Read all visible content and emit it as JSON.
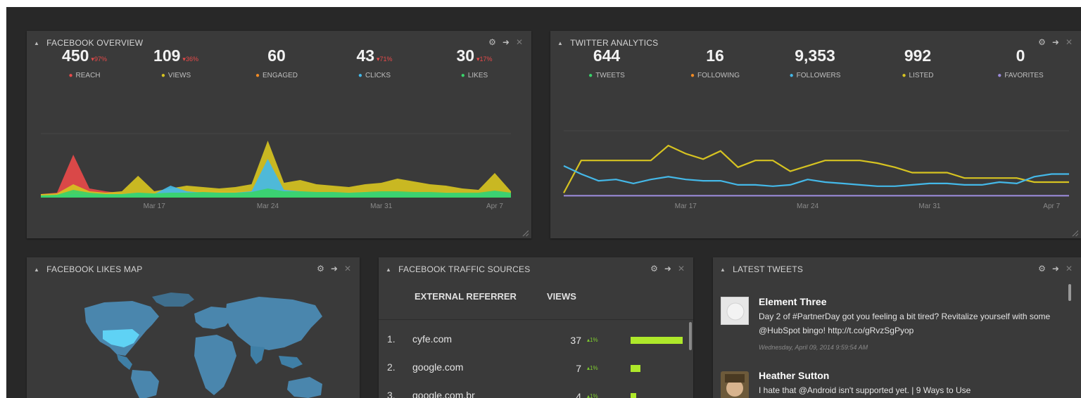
{
  "facebook_overview": {
    "title": "FACEBOOK OVERVIEW",
    "stats": [
      {
        "value": "450",
        "change": "▾97%",
        "label": "REACH",
        "color": "#e84a4a"
      },
      {
        "value": "109",
        "change": "▾36%",
        "label": "VIEWS",
        "color": "#d6c321"
      },
      {
        "value": "60",
        "change": "",
        "label": "ENGAGED",
        "color": "#f08a24"
      },
      {
        "value": "43",
        "change": "▾71%",
        "label": "CLICKS",
        "color": "#44b8e8"
      },
      {
        "value": "30",
        "change": "▾17%",
        "label": "LIKES",
        "color": "#39d36a"
      }
    ],
    "x_ticks": [
      "Mar 17",
      "Mar 24",
      "Mar 31",
      "Apr 7"
    ]
  },
  "twitter_analytics": {
    "title": "TWITTER ANALYTICS",
    "stats": [
      {
        "value": "644",
        "label": "TWEETS",
        "color": "#39d36a"
      },
      {
        "value": "16",
        "label": "FOLLOWING",
        "color": "#f08a24"
      },
      {
        "value": "9,353",
        "label": "FOLLOWERS",
        "color": "#44b8e8"
      },
      {
        "value": "992",
        "label": "LISTED",
        "color": "#d6c321"
      },
      {
        "value": "0",
        "label": "FAVORITES",
        "color": "#9a8ad8"
      }
    ],
    "x_ticks": [
      "Mar 17",
      "Mar 24",
      "Mar 31",
      "Apr 7"
    ]
  },
  "likes_map": {
    "title": "FACEBOOK LIKES MAP"
  },
  "traffic_sources": {
    "title": "FACEBOOK TRAFFIC SOURCES",
    "col_referrer": "EXTERNAL REFERRER",
    "col_views": "VIEWS",
    "rows": [
      {
        "rank": "1.",
        "name": "cyfe.com",
        "views": "37",
        "change": "▴1%",
        "share": 1.0
      },
      {
        "rank": "2.",
        "name": "google.com",
        "views": "7",
        "change": "▴1%",
        "share": 0.19
      },
      {
        "rank": "3.",
        "name": "google.com.br",
        "views": "4",
        "change": "▴1%",
        "share": 0.11
      }
    ]
  },
  "latest_tweets": {
    "title": "LATEST TWEETS",
    "tweets": [
      {
        "name": "Element Three",
        "text": "Day 2 of #PartnerDay got you feeling a bit tired? Revitalize yourself with some @HubSpot bingo! http://t.co/gRvzSgPyop",
        "time": "Wednesday, April 09, 2014 9:59:54 AM"
      },
      {
        "name": "Heather Sutton",
        "text": "I hate that @Android isn't supported yet. | 9 Ways to Use",
        "time": ""
      }
    ]
  },
  "chart_data": [
    {
      "type": "area",
      "x": [
        "Mar 10",
        "Mar 11",
        "Mar 12",
        "Mar 13",
        "Mar 14",
        "Mar 15",
        "Mar 16",
        "Mar 17",
        "Mar 18",
        "Mar 19",
        "Mar 20",
        "Mar 21",
        "Mar 22",
        "Mar 23",
        "Mar 24",
        "Mar 25",
        "Mar 26",
        "Mar 27",
        "Mar 28",
        "Mar 29",
        "Mar 30",
        "Mar 31",
        "Apr 1",
        "Apr 2",
        "Apr 3",
        "Apr 4",
        "Apr 5",
        "Apr 6",
        "Apr 7",
        "Apr 8"
      ],
      "series": [
        {
          "name": "REACH",
          "color": "#e84a4a",
          "values": [
            4,
            6,
            60,
            12,
            8,
            5,
            4,
            6,
            6,
            8,
            10,
            9,
            8,
            8,
            12,
            10,
            8,
            6,
            6,
            7,
            8,
            6,
            6,
            5,
            6,
            7,
            6,
            5,
            8,
            6
          ]
        },
        {
          "name": "VIEWS",
          "color": "#d6c321",
          "values": [
            4,
            5,
            18,
            8,
            6,
            8,
            30,
            8,
            12,
            16,
            14,
            12,
            14,
            18,
            80,
            20,
            24,
            18,
            16,
            14,
            18,
            20,
            26,
            22,
            18,
            16,
            12,
            10,
            34,
            8
          ]
        },
        {
          "name": "CLICKS",
          "color": "#44b8e8",
          "values": [
            2,
            2,
            4,
            3,
            3,
            4,
            6,
            4,
            16,
            8,
            6,
            6,
            6,
            8,
            54,
            10,
            8,
            6,
            6,
            5,
            6,
            6,
            6,
            5,
            5,
            5,
            4,
            4,
            8,
            4
          ]
        },
        {
          "name": "LIKES",
          "color": "#39d36a",
          "values": [
            2,
            3,
            10,
            6,
            4,
            4,
            6,
            5,
            6,
            6,
            7,
            6,
            6,
            7,
            12,
            8,
            8,
            7,
            7,
            6,
            7,
            8,
            8,
            7,
            7,
            6,
            6,
            6,
            9,
            6
          ]
        }
      ],
      "ylim": [
        0,
        90
      ],
      "legend": "top"
    },
    {
      "type": "line",
      "x": [
        "Mar 10",
        "Mar 11",
        "Mar 12",
        "Mar 13",
        "Mar 14",
        "Mar 15",
        "Mar 16",
        "Mar 17",
        "Mar 18",
        "Mar 19",
        "Mar 20",
        "Mar 21",
        "Mar 22",
        "Mar 23",
        "Mar 24",
        "Mar 25",
        "Mar 26",
        "Mar 27",
        "Mar 28",
        "Mar 29",
        "Mar 30",
        "Mar 31",
        "Apr 1",
        "Apr 2",
        "Apr 3",
        "Apr 4",
        "Apr 5",
        "Apr 6",
        "Apr 7",
        "Apr 8"
      ],
      "series": [
        {
          "name": "LISTED",
          "color": "#d6c321",
          "values": [
            2,
            50,
            50,
            50,
            50,
            50,
            72,
            60,
            52,
            64,
            40,
            50,
            50,
            34,
            42,
            50,
            50,
            50,
            46,
            40,
            32,
            32,
            32,
            24,
            24,
            24,
            24,
            18,
            18,
            18
          ]
        },
        {
          "name": "FOLLOWERS",
          "color": "#44b8e8",
          "values": [
            42,
            30,
            20,
            22,
            16,
            22,
            26,
            22,
            20,
            20,
            14,
            14,
            12,
            14,
            22,
            18,
            16,
            14,
            12,
            12,
            14,
            16,
            16,
            14,
            14,
            18,
            16,
            26,
            30,
            30
          ]
        },
        {
          "name": "FAVORITES",
          "color": "#9a8ad8",
          "values": [
            -2,
            -2,
            -2,
            -2,
            -2,
            -2,
            -2,
            -2,
            -2,
            -2,
            -2,
            -2,
            -2,
            -2,
            -2,
            -2,
            -2,
            -2,
            -2,
            -2,
            -2,
            -2,
            -2,
            -2,
            -2,
            -2,
            -2,
            -2,
            -2,
            -2
          ]
        }
      ],
      "ylim": [
        -10,
        100
      ],
      "legend": "top"
    }
  ]
}
